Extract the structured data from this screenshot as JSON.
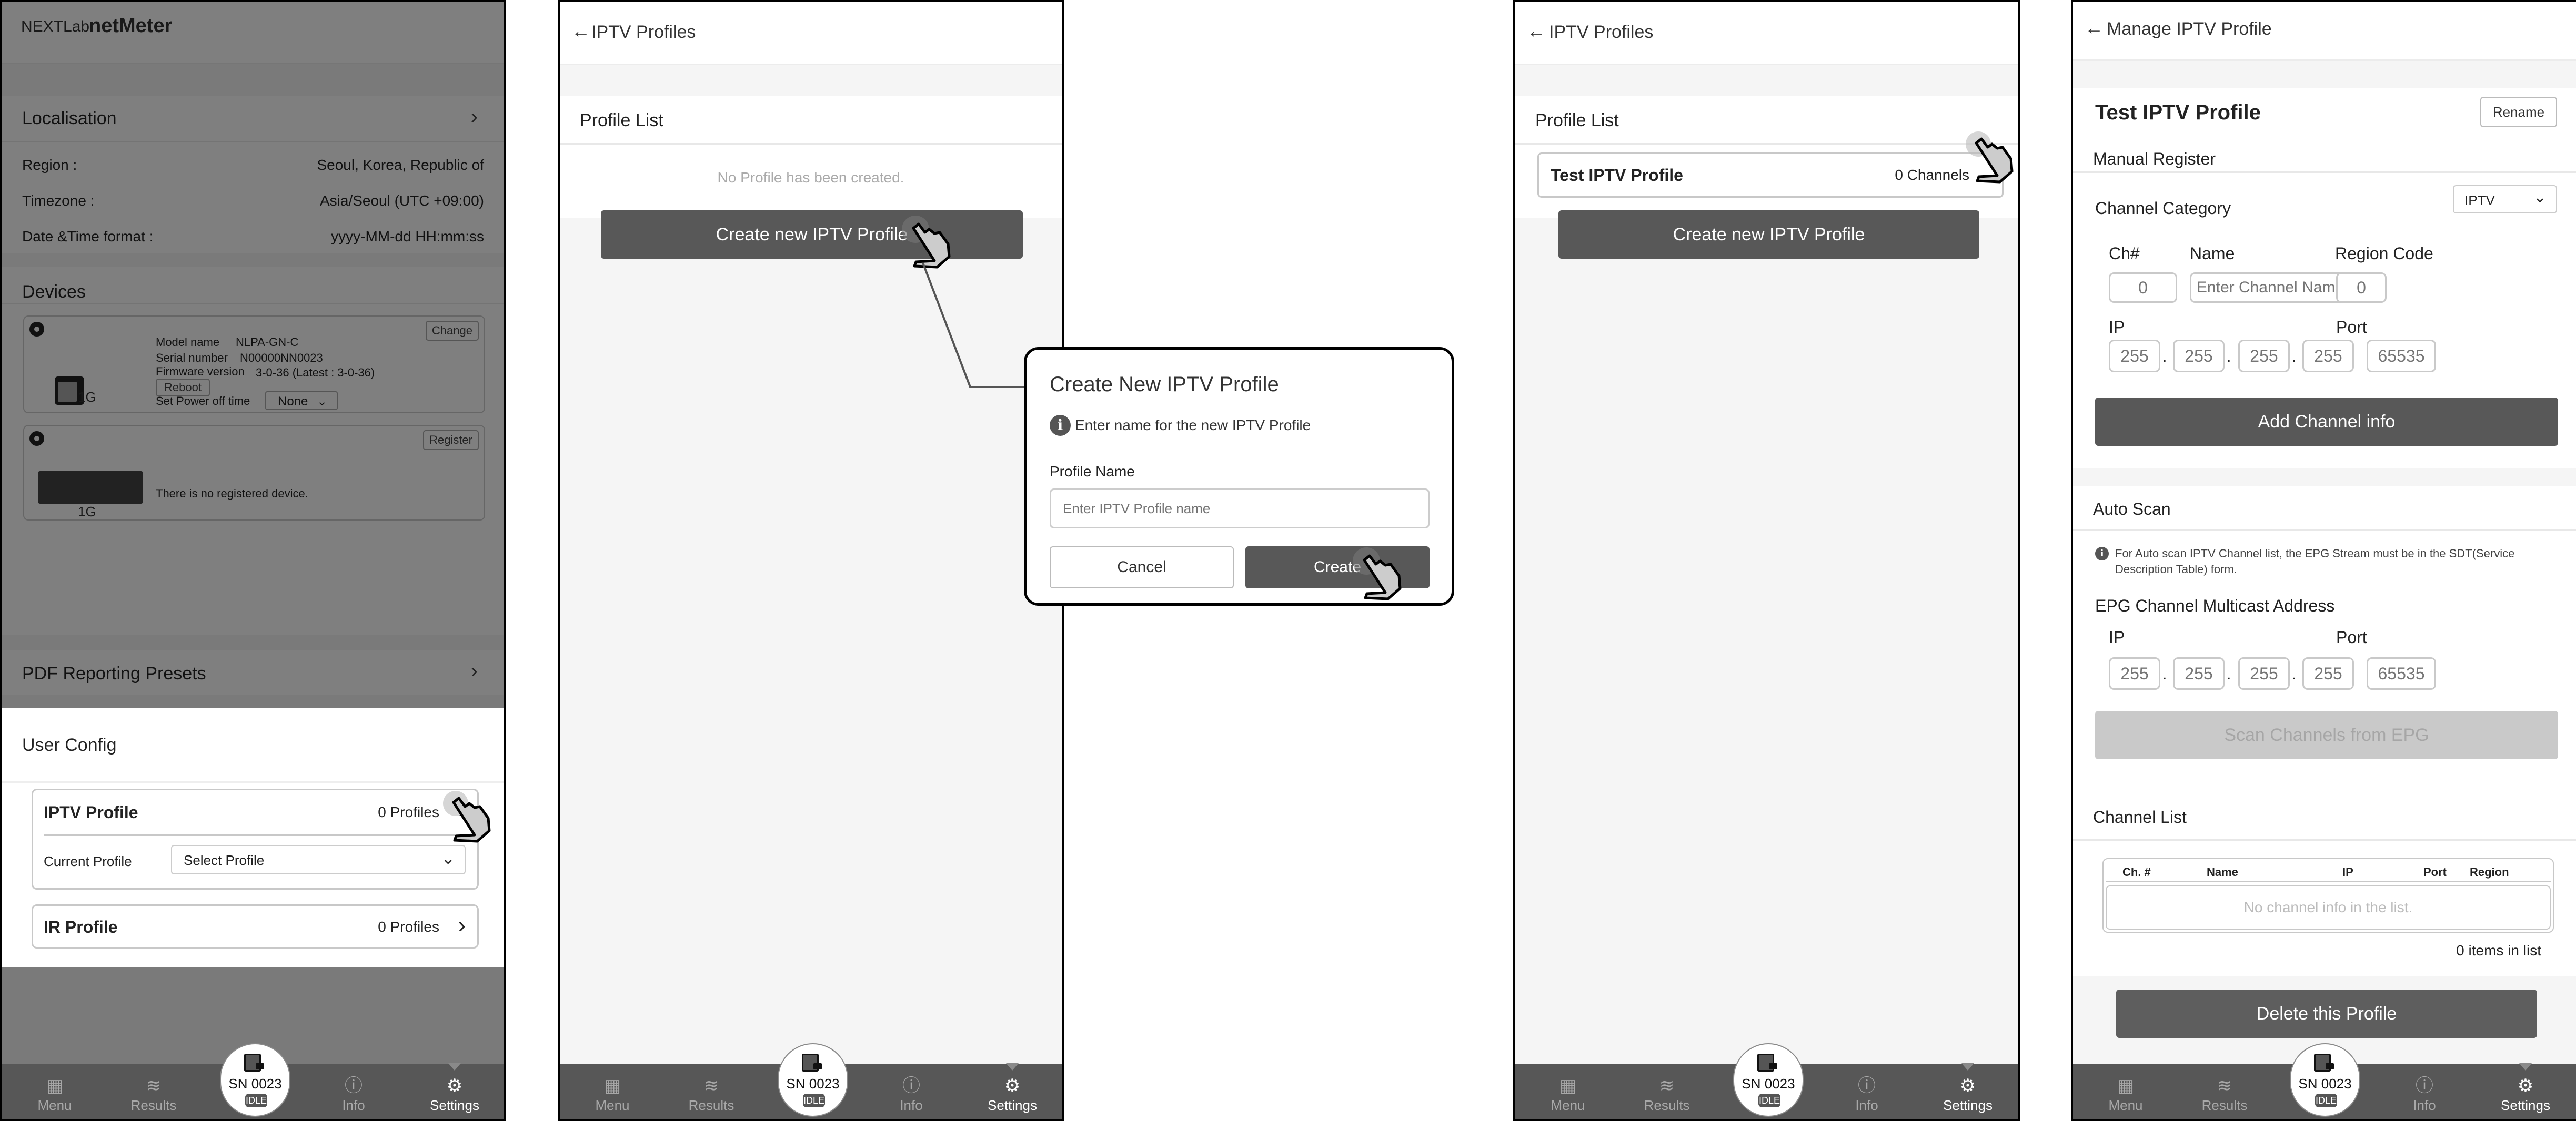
{
  "nav": {
    "items": [
      {
        "label": "Menu",
        "icon": "grid-icon"
      },
      {
        "label": "Results",
        "icon": "layers-icon"
      },
      {
        "label": "Info",
        "icon": "info-icon"
      },
      {
        "label": "Settings",
        "icon": "gear-icon"
      }
    ],
    "device_serial": "SN 0023",
    "device_status": "IDLE",
    "active": "Settings"
  },
  "panel1": {
    "app_brand": "NEXTLab",
    "app_name": "netMeter",
    "localisation": {
      "title": "Localisation",
      "rows": [
        {
          "label": "Region :",
          "value": "Seoul, Korea, Republic of"
        },
        {
          "label": "Timezone :",
          "value": "Asia/Seoul (UTC +09:00)"
        },
        {
          "label": "Date &Time format :",
          "value": "yyyy-MM-dd HH:mm:ss"
        }
      ]
    },
    "devices": {
      "title": "Devices",
      "device1": {
        "change_label": "Change",
        "model_label": "Model name",
        "model_value": "NLPA-GN-C",
        "serial_label": "Serial number",
        "serial_value": "N00000NN0023",
        "firmware_label": "Firmware version",
        "firmware_value": "3-0-36 (Latest : 3-0-36)",
        "reboot_label": "Reboot",
        "power_label": "Set Power off time",
        "power_value": "None",
        "speed": "1G"
      },
      "device2": {
        "register_label": "Register",
        "empty_text": "There is no registered device.",
        "speed": "1G"
      }
    },
    "pdf_presets": "PDF Reporting Presets",
    "user_config": {
      "title": "User Config",
      "iptv_label": "IPTV Profile",
      "iptv_count": "0 Profiles",
      "current_profile_label": "Current Profile",
      "current_profile_value": "Select Profile",
      "ir_label": "IR Profile",
      "ir_count": "0 Profiles"
    }
  },
  "panel2": {
    "header": "IPTV Profiles",
    "list_title": "Profile List",
    "empty_text": "No Profile has been created.",
    "create_button": "Create new IPTV Profile"
  },
  "dialog": {
    "title": "Create New IPTV Profile",
    "info": "Enter name for the new IPTV Profile",
    "field_label": "Profile Name",
    "field_placeholder": "Enter IPTV Profile name",
    "cancel": "Cancel",
    "create": "Create"
  },
  "panel3": {
    "header": "IPTV Profiles",
    "list_title": "Profile List",
    "profile_name": "Test IPTV Profile",
    "profile_count": "0 Channels",
    "create_button": "Create new IPTV Profile"
  },
  "panel4": {
    "header": "Manage IPTV Profile",
    "profile_name": "Test IPTV Profile",
    "rename": "Rename",
    "manual_register": "Manual Register",
    "channel_category_label": "Channel Category",
    "channel_category_value": "IPTV",
    "ch_label": "Ch#",
    "ch_placeholder": "0",
    "name_label": "Name",
    "name_placeholder": "Enter Channel Name",
    "region_label": "Region Code",
    "region_placeholder": "0",
    "ip_label": "IP",
    "ip_placeholder": "255",
    "port_label": "Port",
    "port_placeholder": "65535",
    "add_channel": "Add Channel info",
    "auto_scan": "Auto Scan",
    "auto_scan_info": "For Auto scan IPTV Channel list, the EPG Stream must be in the SDT(Service Description Table) form.",
    "epg_title": "EPG Channel Multicast Address",
    "epg_ip_label": "IP",
    "epg_port_label": "Port",
    "scan_button": "Scan Channels from EPG",
    "channel_list_title": "Channel List",
    "columns": [
      "Ch. #",
      "Name",
      "IP",
      "Port",
      "Region"
    ],
    "empty_text": "No channel info in the list.",
    "items_count": "0 items in list",
    "delete_button": "Delete this Profile"
  }
}
